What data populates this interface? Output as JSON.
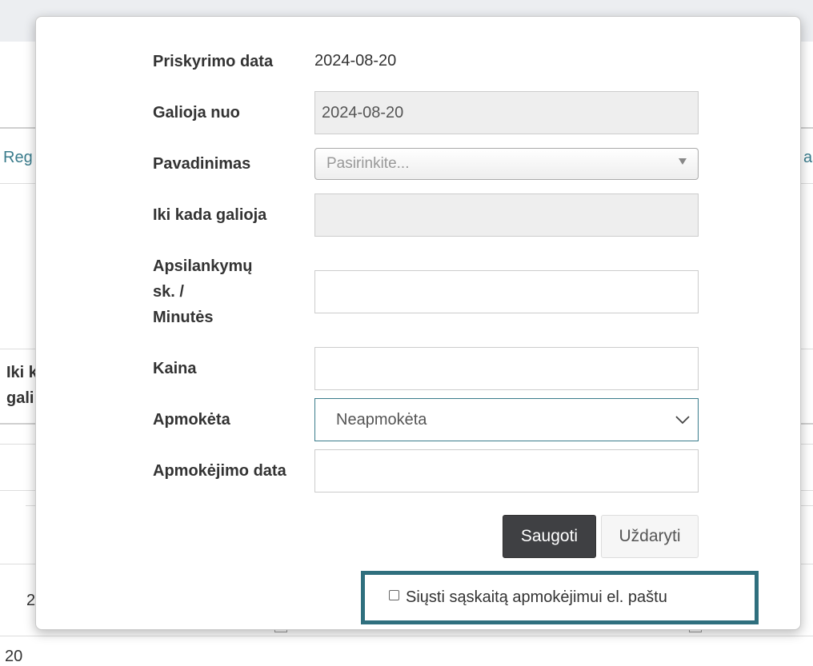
{
  "background": {
    "link_left": "Reg",
    "link_right": "as",
    "header_left_line1": "Iki k",
    "header_left_line2": "gali",
    "row_value_1": "2",
    "row_value_2": "20"
  },
  "form": {
    "assign_date": {
      "label": "Priskyrimo data",
      "value": "2024-08-20"
    },
    "valid_from": {
      "label": "Galioja nuo",
      "value": "2024-08-20"
    },
    "name": {
      "label": "Pavadinimas",
      "placeholder": "Pasirinkite..."
    },
    "valid_until": {
      "label": "Iki kada galioja",
      "value": ""
    },
    "visits": {
      "label_line1": "Apsilankymų",
      "label_line2": "sk. /",
      "label_line3": "Minutės",
      "value": ""
    },
    "price": {
      "label": "Kaina",
      "value": ""
    },
    "paid": {
      "label": "Apmokėta",
      "selected": "Neapmokėta"
    },
    "payment_date": {
      "label": "Apmokėjimo data",
      "value": ""
    }
  },
  "buttons": {
    "save": "Saugoti",
    "close": "Uždaryti"
  },
  "email_option": {
    "label": "Siųsti sąskaitą apmokėjimui el. paštu",
    "checked": false
  },
  "colors": {
    "accent": "#2f6f7e",
    "save_button": "#3f4043",
    "readonly_bg": "#eeeeee"
  }
}
